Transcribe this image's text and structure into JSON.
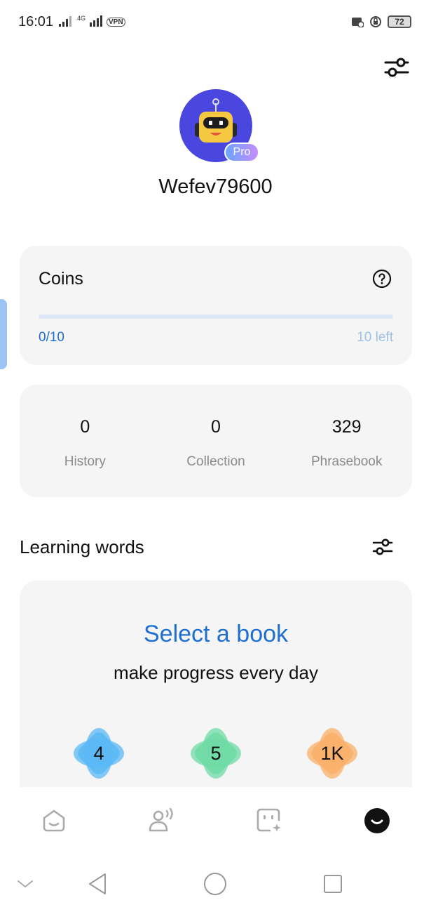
{
  "status_bar": {
    "time": "16:01",
    "network_label": "4G",
    "vpn_label": "VPN",
    "battery": "72"
  },
  "profile": {
    "username": "Wefev79600",
    "badge": "Pro"
  },
  "coins": {
    "title": "Coins",
    "progress_text": "0/10",
    "left_text": "10 left",
    "progress_fraction": 0
  },
  "stats": [
    {
      "value": "0",
      "label": "History"
    },
    {
      "value": "0",
      "label": "Collection"
    },
    {
      "value": "329",
      "label": "Phrasebook"
    }
  ],
  "learning": {
    "section_title": "Learning words",
    "book_title": "Select a book",
    "book_subtitle": "make progress every day",
    "levels": [
      {
        "label": "4",
        "color": "#5bb8f5"
      },
      {
        "label": "5",
        "color": "#6fdba6"
      },
      {
        "label": "1K",
        "color": "#f9b06a"
      }
    ]
  },
  "bottom_nav": {
    "items": [
      {
        "icon": "home-face-icon"
      },
      {
        "icon": "voice-person-icon"
      },
      {
        "icon": "ai-chat-icon"
      },
      {
        "icon": "profile-face-icon",
        "active": true
      }
    ]
  },
  "colors": {
    "accent": "#1e6fd0",
    "card_bg": "#f5f5f5",
    "avatar_bg": "#4a47e0"
  }
}
